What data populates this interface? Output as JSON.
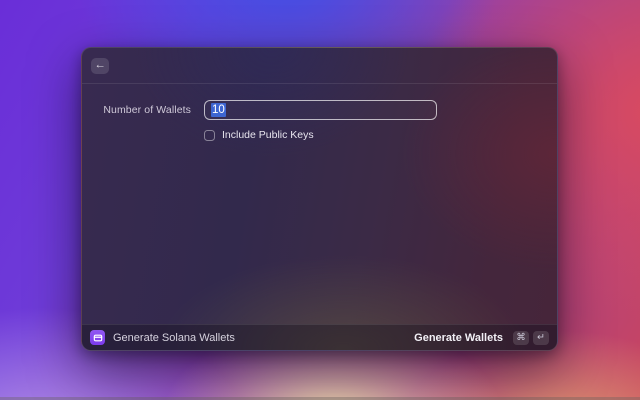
{
  "window": {
    "header": {
      "back_icon": "←"
    },
    "form": {
      "wallet_count_label": "Number of Wallets",
      "wallet_count_value": "10",
      "include_public_keys_label": "Include Public Keys",
      "include_public_keys_checked": false
    },
    "footer": {
      "command_icon": "wallet-icon",
      "command_name": "Generate Solana Wallets",
      "primary_action_label": "Generate Wallets",
      "shortcut_keys": [
        "⌘",
        "↵"
      ]
    }
  },
  "colors": {
    "accent_purple": "#7c3aed",
    "selection_blue": "#3e70e8",
    "background_gradient": [
      "#6a2ed8",
      "#3f50e6",
      "#d94a60",
      "#b392ea",
      "#ecd9ab"
    ]
  }
}
